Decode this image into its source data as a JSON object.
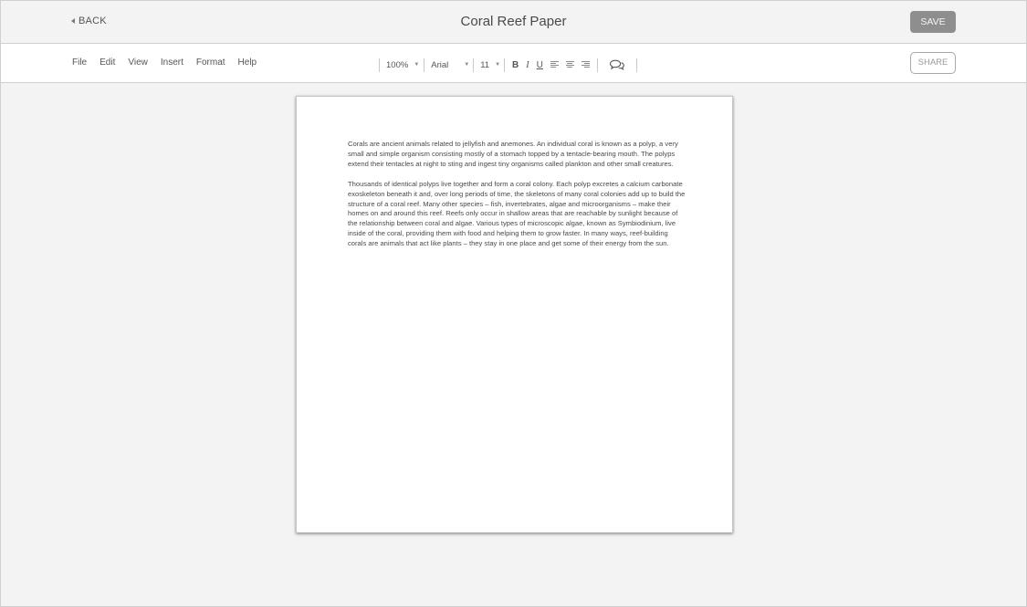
{
  "header": {
    "back_label": "BACK",
    "title": "Coral Reef Paper",
    "save_label": "SAVE"
  },
  "toolbar": {
    "menu": [
      "File",
      "Edit",
      "View",
      "Insert",
      "Format",
      "Help"
    ],
    "zoom": "100%",
    "font": "Arial",
    "font_size": "11",
    "bold_label": "B",
    "italic_label": "I",
    "underline_label": "U",
    "share_label": "SHARE"
  },
  "document": {
    "paragraphs": [
      "Corals are ancient animals related to jellyfish and anemones. An individual coral is known as a polyp, a very small and simple organism consisting mostly of a stomach topped by a tentacle-bearing mouth. The polyps extend their tentacles at night to sting and ingest tiny organisms called plankton and other small creatures.",
      "Thousands of identical polyps live together and form a coral colony. Each polyp excretes a calcium carbonate exoskeleton beneath it and, over long periods of time, the skeletons of many coral colonies add up to build the structure of a coral reef. Many other species – fish, invertebrates, algae and microorganisms – make their homes on and around this reef. Reefs only occur in shallow areas that are reachable by sunlight because of the relationship between coral and algae. Various types of microscopic algae, known as Symbiodinium, live inside of the coral, providing them with food and helping them to grow faster. In many ways, reef-building corals are animals that act like plants – they stay in one place and get some of their energy from the sun."
    ]
  },
  "icons": {
    "back": "caret-left-icon",
    "comment": "comment-icon",
    "align_left": "align-left-icon",
    "align_center": "align-center-icon",
    "align_right": "align-right-icon"
  },
  "colors": {
    "save_button": "#8e8e8e",
    "app_background": "#f3f3f3",
    "page_background": "#ffffff"
  }
}
